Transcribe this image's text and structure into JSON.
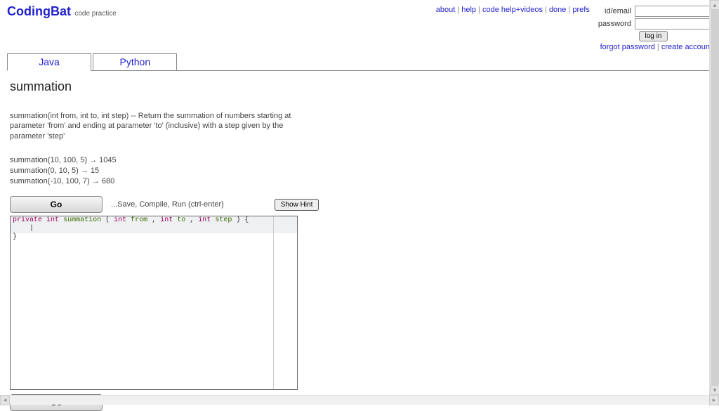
{
  "header": {
    "logo": "CodingBat",
    "logo_sub": "code practice",
    "links": {
      "about": "about",
      "help": "help",
      "codehelp": "code help+videos",
      "done": "done",
      "prefs": "prefs"
    },
    "login": {
      "id_label": "id/email",
      "pw_label": "password",
      "button": "log in",
      "forgot": "forgot password",
      "create": "create account"
    }
  },
  "tabs": {
    "java": "Java",
    "python": "Python"
  },
  "problem": {
    "title": "summation",
    "desc": "summation(int from, int to, int step) -- Return the summation of numbers starting at parameter 'from' and ending at parameter 'to' (inclusive) with a step given by the parameter 'step'",
    "examples": [
      "summation(10, 100, 5) → 1045",
      "summation(0, 10, 5) → 15",
      "summation(-10, 100, 7) → 680"
    ],
    "go_label": "Go",
    "run_hint": "...Save, Compile, Run (ctrl-enter)",
    "show_hint": "Show Hint",
    "code": {
      "line1": {
        "kw1": "private",
        "ty1": "int",
        "fn": "summation",
        "p_open": "(",
        "ty2": "int",
        "a1": "from",
        "c1": ", ",
        "ty3": "int",
        "a2": "to",
        "c2": ", ",
        "ty4": "int",
        "a3": "step",
        "p_close": ")",
        "brace": " {"
      },
      "line3": "}"
    }
  }
}
